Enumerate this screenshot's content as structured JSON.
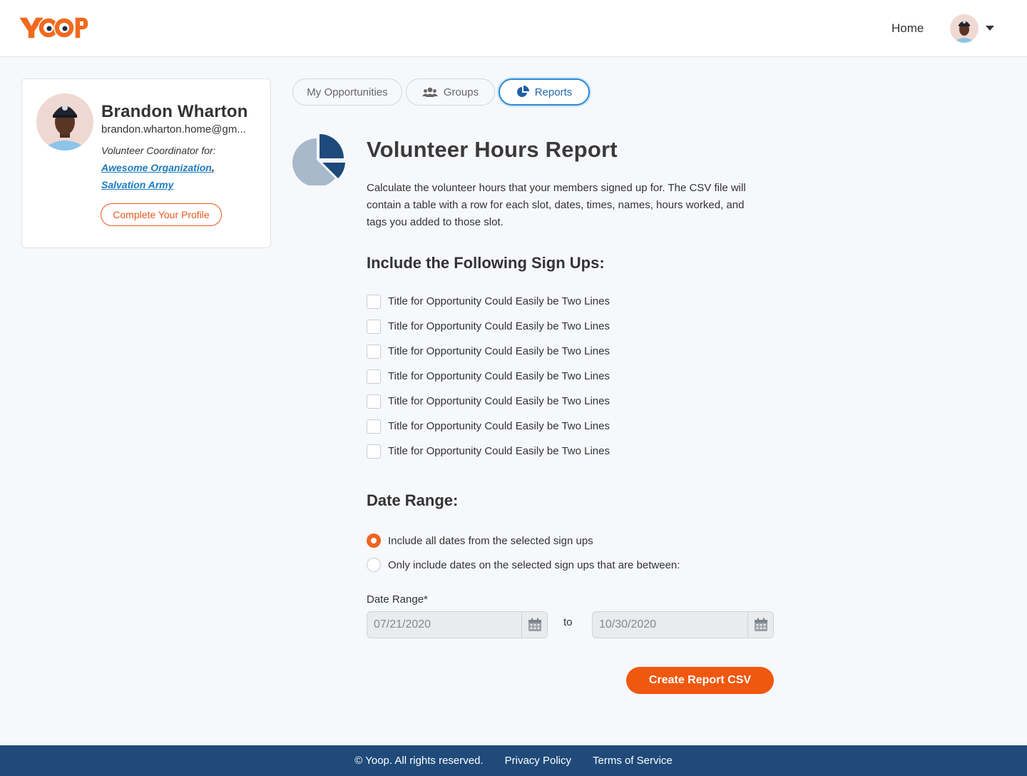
{
  "header": {
    "logo_text": "YOOP",
    "nav_home": "Home"
  },
  "profile": {
    "name": "Brandon Wharton",
    "email": "brandon.wharton.home@gm...",
    "role_label": "Volunteer Coordinator for:",
    "organizations": [
      "Awesome Organization",
      "Salvation Army"
    ],
    "org_separator": ",",
    "complete_profile_label": "Complete Your Profile"
  },
  "tabs": [
    {
      "label": "My Opportunities",
      "icon": "none",
      "active": false
    },
    {
      "label": "Groups",
      "icon": "users-icon",
      "active": false
    },
    {
      "label": "Reports",
      "icon": "pie-chart-icon",
      "active": true
    }
  ],
  "report": {
    "title": "Volunteer Hours Report",
    "description": "Calculate the volunteer hours that your members signed up for.  The  CSV file will contain a table with a row for each slot, dates, times, names, hours worked, and tags you added to those slot.",
    "signups_heading": "Include the Following Sign Ups:",
    "signups": [
      "Title for Opportunity Could Easily be Two Lines",
      "Title for Opportunity Could Easily be Two Lines",
      "Title for Opportunity Could Easily be Two Lines",
      "Title for Opportunity Could Easily be Two Lines",
      "Title for Opportunity Could Easily be Two Lines",
      "Title for Opportunity Could Easily be Two Lines",
      "Title for Opportunity Could Easily be Two Lines"
    ],
    "date_heading": "Date Range:",
    "radio_all": "Include all dates from the selected sign ups",
    "radio_between": "Only include dates on the selected sign ups that are between:",
    "date_range_label": "Date Range*",
    "date_from": "07/21/2020",
    "date_to": "10/30/2020",
    "to_text": "to",
    "create_label": "Create Report CSV"
  },
  "footer": {
    "copyright": "© Yoop. All rights reserved.",
    "privacy": "Privacy Policy",
    "terms": "Terms of Service"
  },
  "colors": {
    "brand_orange": "#f0580f",
    "link_blue": "#1b7bbf",
    "footer_navy": "#1f4a7a",
    "tab_active_blue": "#2b8ad6"
  }
}
